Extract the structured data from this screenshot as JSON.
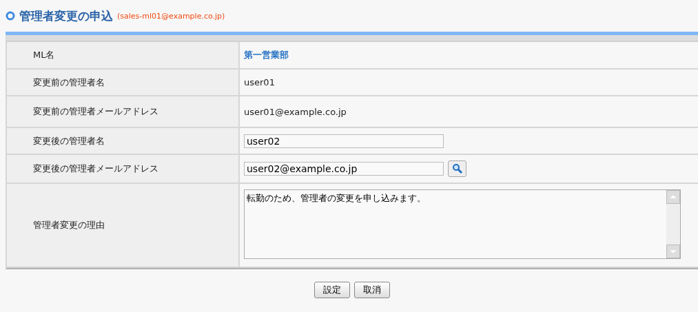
{
  "heading": {
    "title": "管理者変更の申込",
    "address": "(sales-ml01@example.co.jp)"
  },
  "rows": [
    {
      "label": "ML名",
      "kind": "strong",
      "value": "第一営業部"
    },
    {
      "label": "変更前の管理者名",
      "kind": "text",
      "value": "user01"
    },
    {
      "label": "変更前の管理者メールアドレス",
      "kind": "text",
      "value": "user01@example.co.jp"
    },
    {
      "label": "変更後の管理者名",
      "kind": "input",
      "value": "user02"
    },
    {
      "label": "変更後の管理者メールアドレス",
      "kind": "lookup",
      "value": "user02@example.co.jp"
    },
    {
      "label": "管理者変更の理由",
      "kind": "textarea",
      "value": "転勤のため、管理者の変更を申し込みます。"
    }
  ],
  "buttons": [
    "設定",
    "取消"
  ]
}
